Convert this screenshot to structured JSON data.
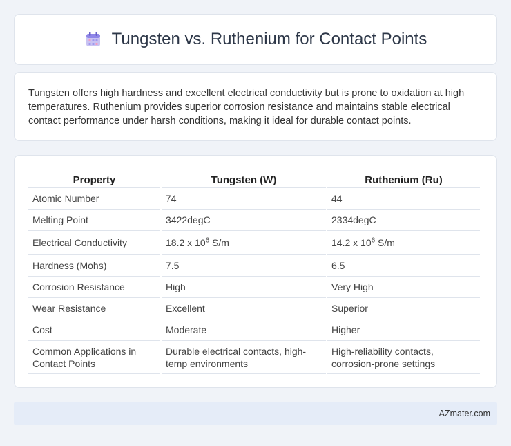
{
  "header": {
    "title": "Tungsten vs. Ruthenium for Contact Points",
    "icon": "calendar-icon"
  },
  "description": "Tungsten offers high hardness and excellent electrical conductivity but is prone to oxidation at high temperatures. Ruthenium provides superior corrosion resistance and maintains stable electrical contact performance under harsh conditions, making it ideal for durable contact points.",
  "table": {
    "headers": [
      "Property",
      "Tungsten (W)",
      "Ruthenium (Ru)"
    ],
    "rows": [
      [
        "Atomic Number",
        "74",
        "44"
      ],
      [
        "Melting Point",
        "3422degC",
        "2334degC"
      ],
      [
        "Electrical Conductivity",
        "18.2 x 10",
        "14.2 x 10"
      ],
      [
        "Hardness (Mohs)",
        "7.5",
        "6.5"
      ],
      [
        "Corrosion Resistance",
        "High",
        "Very High"
      ],
      [
        "Wear Resistance",
        "Excellent",
        "Superior"
      ],
      [
        "Cost",
        "Moderate",
        "Higher"
      ],
      [
        "Common Applications in Contact Points",
        "Durable electrical contacts, high-temp environments",
        "High-reliability contacts, corrosion-prone settings"
      ]
    ],
    "conductivity_exponent": "6",
    "conductivity_unit": " S/m"
  },
  "footer": {
    "text": "AZmater.com"
  }
}
